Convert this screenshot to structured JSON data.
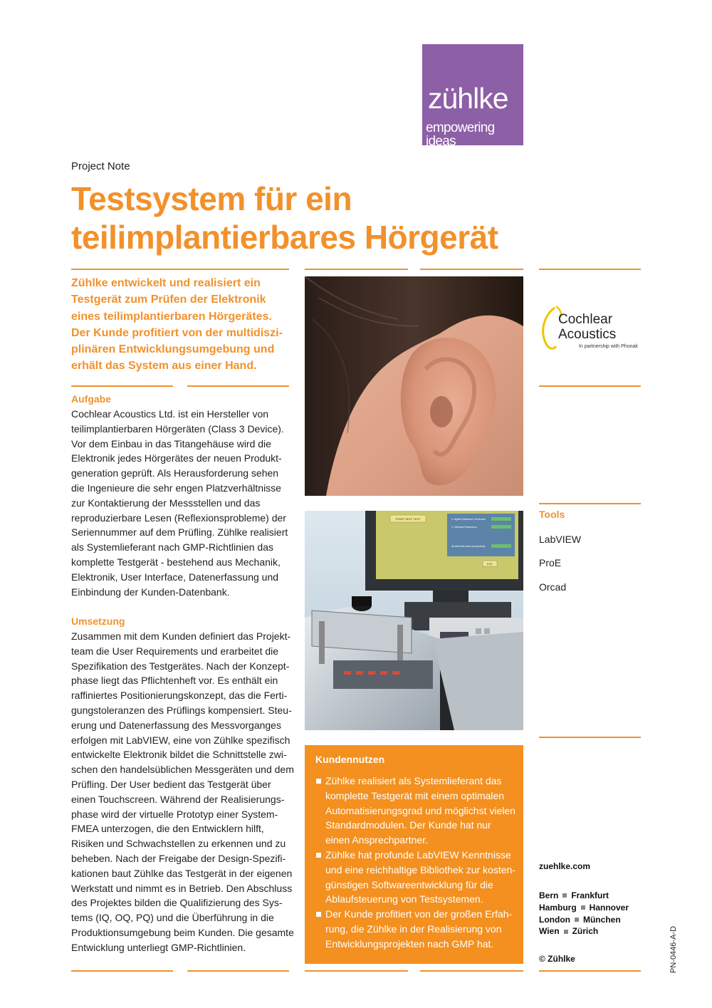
{
  "brand": {
    "name": "zühlke",
    "tagline": "empowering ideas",
    "color": "#8d5fa6"
  },
  "kicker": "Project Note",
  "title_lines": [
    "Testsystem für ein",
    "teilimplantierbares Hörgerät"
  ],
  "accent_color": "#f2912b",
  "intro_lines": [
    "Zühlke entwickelt und realisiert ein",
    "Testgerät zum Prüfen der Elektronik",
    "eines teilimplantierbaren Hörgerätes.",
    "Der Kunde profitiert von der multidiszi-",
    "plinären Entwicklungsumgebung und",
    "erhält das System aus einer Hand."
  ],
  "aufgabe": {
    "heading": "Aufgabe",
    "lines": [
      "Cochlear Acoustics Ltd. ist ein Hersteller von",
      "teilimplantierbaren Hörgeräten (Class 3 Device).",
      "Vor dem Einbau in das Titangehäuse wird die",
      "Elektronik jedes Hörgerätes der neuen Produkt-",
      "generation geprüft. Als Herausforderung sehen",
      "die Ingenieure die sehr engen Platzverhältnisse",
      "zur Kontaktierung der Messstellen und das",
      "reproduzierbare Lesen (Reflexionsprobleme) der",
      "Seriennummer auf dem Prüfling. Zühlke realisiert",
      "als Systemlieferant nach GMP-Richtlinien das",
      "komplette Testgerät - bestehend aus Mechanik,",
      "Elektronik, User Interface, Datenerfassung und",
      "Einbindung der Kunden-Datenbank."
    ]
  },
  "umsetzung": {
    "heading": "Umsetzung",
    "lines": [
      "Zusammen mit dem Kunden definiert das Projekt-",
      "team die User Requirements und erarbeitet die",
      "Spezifikation des Testgerätes. Nach der Konzept-",
      "phase liegt das Pflichtenheft vor. Es enthält ein",
      "raffiniertes Positionierungskonzept, das die Ferti-",
      "gungstoleranzen des Prüflings kompensiert. Steu-",
      "erung und Datenerfassung des Messvorganges",
      "erfolgen mit LabVIEW, eine von Zühlke spezifisch",
      "entwickelte Elektronik bildet die Schnittstelle zwi-",
      "schen den handelsüblichen Messgeräten und dem",
      "Prüfling. Der User bedient das Testgerät über",
      "einen Touchscreen. Während der Realisierungs-",
      "phase wird der virtuelle Prototyp einer System-",
      "FMEA unterzogen, die den Entwicklern hilft,",
      "Risiken und Schwachstellen zu erkennen und zu",
      "beheben. Nach der Freigabe der Design-Spezifi-",
      "kationen baut Zühlke das Testgerät in der eigenen",
      "Werkstatt und nimmt es in Betrieb. Den Abschluss",
      "des Projektes bilden die Qualifizierung des Sys-",
      "tems (IQ, OQ, PQ) und die Überführung in die",
      "Produktionsumgebung beim Kunden. Die gesamte",
      "Entwicklung unterliegt GMP-Richtlinien."
    ]
  },
  "partner": {
    "name_line1": "Cochlear",
    "name_line2": "Acoustics",
    "subline": "In partnership with Phonak"
  },
  "tools": {
    "heading": "Tools",
    "items": [
      "LabVIEW",
      "ProE",
      "Orcad"
    ]
  },
  "benefits": {
    "heading": "Kundennutzen",
    "items": [
      [
        "Zühlke realisiert als Systemlieferant das",
        "komplette Testgerät mit einem optimalen",
        "Automatisierungsgrad und möglichst vielen",
        "Standardmodulen. Der Kunde hat nur",
        "einen Ansprechpartner."
      ],
      [
        "Zühlke hat profunde LabVIEW Kenntnisse",
        "und eine reichhaltige Bibliothek zur kosten-",
        "günstigen Softwareentwicklung für die",
        "Ablaufsteuerung von Testsystemen."
      ],
      [
        "Der Kunde profitiert von der großen Erfah-",
        "rung, die Zühlke in der Realisierung von",
        "Entwicklungsprojekten nach GMP hat."
      ]
    ],
    "color": "#f3901f"
  },
  "screen_ui": {
    "top_button": "START SELF TEST",
    "items": [
      "1. Agilent Waveform Generator",
      "2. Interface Electronics",
      "All self tests done successfully"
    ],
    "exit": "EXIT"
  },
  "contact": {
    "website": "zuehlke.com",
    "cities": [
      [
        "Bern",
        "Frankfurt"
      ],
      [
        "Hamburg",
        "Hannover"
      ],
      [
        "London",
        "München"
      ],
      [
        "Wien",
        "Zürich"
      ]
    ],
    "copyright": "© Zühlke"
  },
  "doc_id": "PN-0446-A-D"
}
